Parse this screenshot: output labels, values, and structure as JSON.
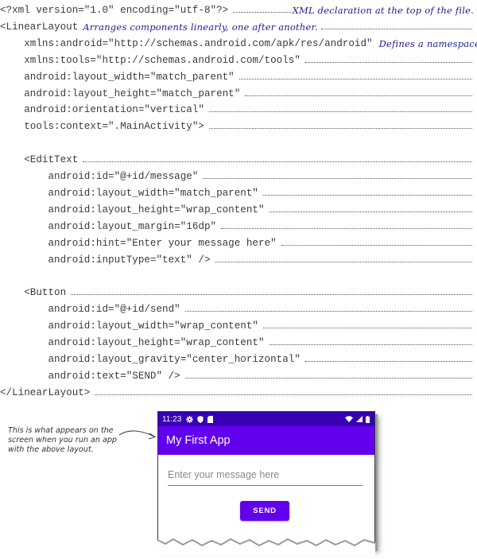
{
  "code_lines": [
    {
      "text": "<?xml version=\"1.0\" encoding=\"utf-8\"?>",
      "annotation": "XML declaration at the top of the file."
    },
    {
      "text": "<LinearLayout",
      "annotation": "Arranges components linearly, one after another."
    },
    {
      "text": "    xmlns:android=\"http://schemas.android.com/apk/res/android\"",
      "annotation": "Defines a namespace."
    },
    {
      "text": "    xmlns:tools=\"http://schemas.android.com/tools\"",
      "annotation": ""
    },
    {
      "text": "    android:layout_width=\"match_parent\"",
      "annotation": ""
    },
    {
      "text": "    android:layout_height=\"match_parent\"",
      "annotation": ""
    },
    {
      "text": "    android:orientation=\"vertical\"",
      "annotation": ""
    },
    {
      "text": "    tools:context=\".MainActivity\">",
      "annotation": ""
    },
    {
      "text": "",
      "annotation": ""
    },
    {
      "text": "    <EditText",
      "annotation": ""
    },
    {
      "text": "        android:id=\"@+id/message\"",
      "annotation": ""
    },
    {
      "text": "        android:layout_width=\"match_parent\"",
      "annotation": ""
    },
    {
      "text": "        android:layout_height=\"wrap_content\"",
      "annotation": ""
    },
    {
      "text": "        android:layout_margin=\"16dp\"",
      "annotation": ""
    },
    {
      "text": "        android:hint=\"Enter your message here\"",
      "annotation": ""
    },
    {
      "text": "        android:inputType=\"text\" />",
      "annotation": ""
    },
    {
      "text": "",
      "annotation": ""
    },
    {
      "text": "    <Button",
      "annotation": ""
    },
    {
      "text": "        android:id=\"@+id/send\"",
      "annotation": ""
    },
    {
      "text": "        android:layout_width=\"wrap_content\"",
      "annotation": ""
    },
    {
      "text": "        android:layout_height=\"wrap_content\"",
      "annotation": ""
    },
    {
      "text": "        android:layout_gravity=\"center_horizontal\"",
      "annotation": ""
    },
    {
      "text": "        android:text=\"SEND\" />",
      "annotation": ""
    },
    {
      "text": "</LinearLayout>",
      "annotation": ""
    }
  ],
  "caption": "This is what appears on the screen when you run an app with the above layout.",
  "phone": {
    "time": "11:23",
    "app_title": "My First App",
    "hint": "Enter your message here",
    "button_label": "SEND",
    "colors": {
      "status_bar": "#3700b3",
      "app_bar": "#6200ee",
      "button": "#6200ee"
    },
    "status_icons": [
      "gear-icon",
      "shield-icon",
      "sim-card-icon"
    ],
    "right_icons": [
      "wifi-icon",
      "signal-icon",
      "battery-icon"
    ]
  }
}
